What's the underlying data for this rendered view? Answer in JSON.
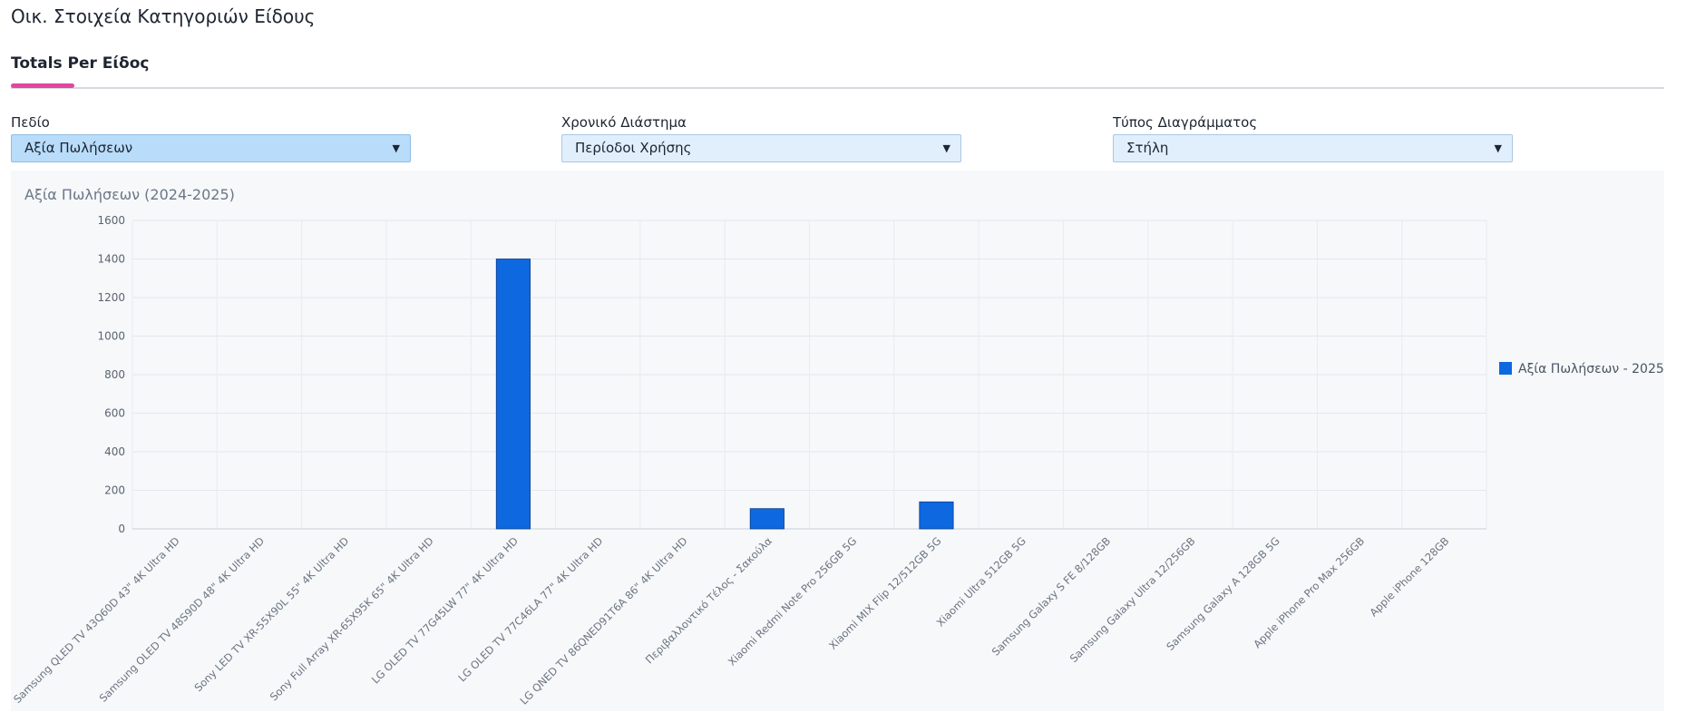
{
  "page": {
    "title": "Οικ. Στοιχεία Κατηγοριών Είδους"
  },
  "tabs": [
    {
      "label": "Totals Per Είδος",
      "active": true
    }
  ],
  "filters": {
    "field": {
      "label": "Πεδίο",
      "value": "Αξία Πωλήσεων"
    },
    "period": {
      "label": "Χρονικό Διάστημα",
      "value": "Περίοδοι Χρήσης"
    },
    "chart_type": {
      "label": "Τύπος Διαγράμματος",
      "value": "Στήλη"
    }
  },
  "colors": {
    "accent_tab": "#e0479e",
    "bar": "#0e68e0",
    "select_bg": "#e1effd",
    "select_active_bg": "#b9dcfa"
  },
  "chart_data": {
    "type": "bar",
    "title": "Αξία Πωλήσεων (2024-2025)",
    "categories": [
      "Samsung QLED TV 43Q60D 43\" 4K Ultra HD",
      "Samsung OLED TV 48S90D 48\" 4K Ultra HD",
      "Sony LED TV XR-55X90L 55\" 4K Ultra HD",
      "Sony Full Array XR-65X95K 65\" 4K Ultra HD",
      "LG OLED TV 77G45LW 77\" 4K Ultra HD",
      "LG OLED TV 77C46LA 77\" 4K Ultra HD",
      "LG QNED TV 86QNED91T6A 86\" 4K Ultra HD",
      "Περιβαλλοντικό Τέλος - Σακούλα",
      "Xiaomi Redmi Note Pro 256GB 5G",
      "Xiaomi MIX Flip 12/512GB 5G",
      "Xiaomi Ultra 512GB 5G",
      "Samsung Galaxy S FE 8/128GB",
      "Samsung Galaxy  Ultra 12/256GB",
      "Samsung Galaxy A 128GB 5G",
      "Apple iPhone Pro Max 256GB",
      "Apple iPhone 128GB"
    ],
    "series": [
      {
        "name": "Αξία Πωλήσεων - 2025",
        "values": [
          0,
          0,
          0,
          0,
          1400,
          0,
          0,
          105,
          0,
          140,
          0,
          0,
          0,
          0,
          0,
          0
        ]
      }
    ],
    "ylim": [
      0,
      1600
    ],
    "yticks": [
      0,
      200,
      400,
      600,
      800,
      1000,
      1200,
      1400,
      1600
    ],
    "grid": true,
    "legend_position": "right"
  }
}
